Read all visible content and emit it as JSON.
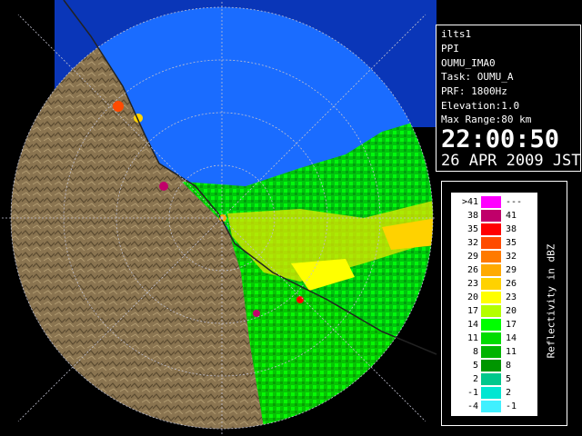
{
  "info": {
    "site": "ilts1",
    "product": "PPI",
    "station": "OUMU_IMA0",
    "task": "Task: OUMU_A",
    "prf": "PRF: 1800Hz",
    "elevation": "Elevation:1.0",
    "max_range": "Max Range:80 km",
    "time": "22:00:50",
    "date": "26 APR 2009 JST"
  },
  "legend": {
    "unit_label": "Reflectivity in dBZ",
    "rows": [
      {
        "lo": ">41",
        "hi": "---",
        "color": "#ff00ff"
      },
      {
        "lo": "38",
        "hi": "41",
        "color": "#c0006a"
      },
      {
        "lo": "35",
        "hi": "38",
        "color": "#ff0000"
      },
      {
        "lo": "32",
        "hi": "35",
        "color": "#ff4a00"
      },
      {
        "lo": "29",
        "hi": "32",
        "color": "#ff7a00"
      },
      {
        "lo": "26",
        "hi": "29",
        "color": "#ffaa00"
      },
      {
        "lo": "23",
        "hi": "26",
        "color": "#ffd200"
      },
      {
        "lo": "20",
        "hi": "23",
        "color": "#ffff00"
      },
      {
        "lo": "17",
        "hi": "20",
        "color": "#b4ff00"
      },
      {
        "lo": "14",
        "hi": "17",
        "color": "#00ff00"
      },
      {
        "lo": "11",
        "hi": "14",
        "color": "#00dc00"
      },
      {
        "lo": "8",
        "hi": "11",
        "color": "#00b400"
      },
      {
        "lo": "5",
        "hi": "8",
        "color": "#009600"
      },
      {
        "lo": "2",
        "hi": "5",
        "color": "#00c88c"
      },
      {
        "lo": "-1",
        "hi": "2",
        "color": "#00e6d2"
      },
      {
        "lo": "-4",
        "hi": "-1",
        "color": "#40f0ff"
      }
    ]
  },
  "colors": {
    "sea": "#1a6cff",
    "sea_outer": "#0a36b8",
    "land": "#8a7450",
    "range_ring": "#c0c0d0"
  }
}
